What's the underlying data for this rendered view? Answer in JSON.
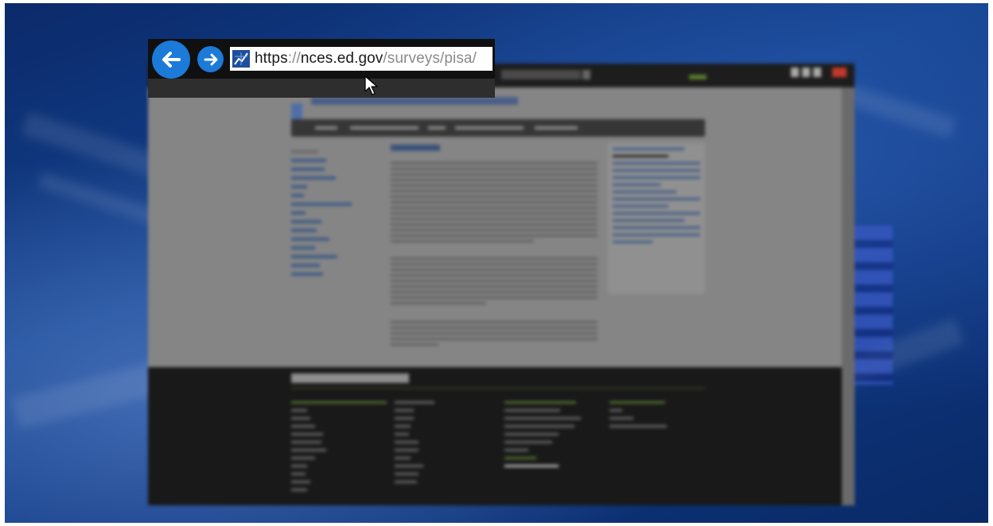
{
  "address_bar": {
    "url_scheme": "https",
    "url_separator": "://",
    "url_domain": "nces.ed.gov",
    "url_path": "/surveys/pisa/"
  },
  "icons": {
    "back": "arrow-left-icon",
    "forward": "arrow-right-icon",
    "favicon": "nces-chart-icon",
    "pointer": "mouse-cursor-icon"
  },
  "colors": {
    "nav_button": "#1c7ad9",
    "favicon": "#1f4e9c",
    "desktop": "#13428f",
    "footer": "#191919"
  }
}
